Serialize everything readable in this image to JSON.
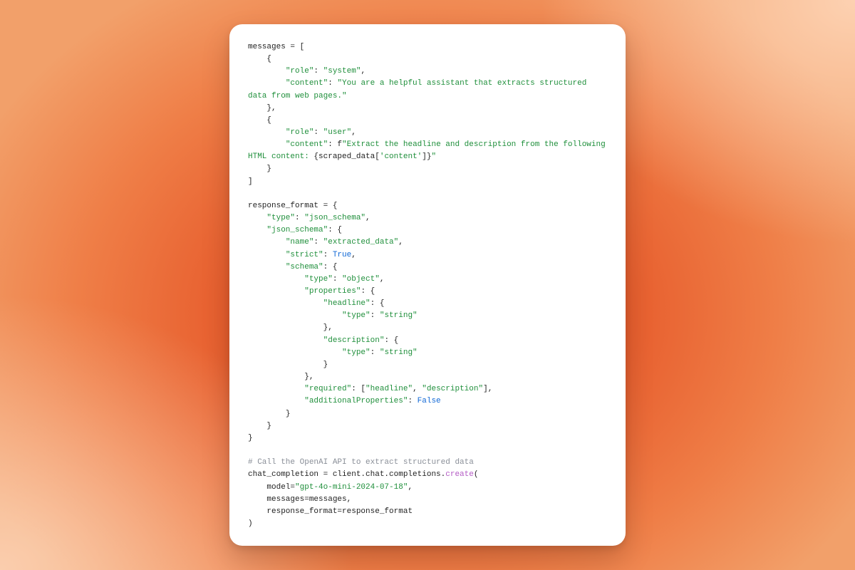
{
  "code": {
    "l1": "messages = [",
    "l2": "    {",
    "l3a": "        ",
    "l3_role_key": "\"role\"",
    "l3b": ": ",
    "l3_role_val": "\"system\"",
    "l3c": ",",
    "l4a": "        ",
    "l4_key": "\"content\"",
    "l4b": ": ",
    "l4_val": "\"You are a helpful assistant that extracts structured data from web pages.\"",
    "l5": "    },",
    "l6": "    {",
    "l7a": "        ",
    "l7_key": "\"role\"",
    "l7b": ": ",
    "l7_val": "\"user\"",
    "l7c": ",",
    "l8a": "        ",
    "l8_key": "\"content\"",
    "l8b": ": f",
    "l8_str1": "\"Extract the headline and description from the following HTML content: ",
    "l8_open": "{",
    "l8_expr": "scraped_data[",
    "l8_idx": "'content'",
    "l8_expr2": "]",
    "l8_close": "}",
    "l8_str2": "\"",
    "l9": "    }",
    "l10": "]",
    "l12": "response_format = {",
    "l13a": "    ",
    "l13_key": "\"type\"",
    "l13b": ": ",
    "l13_val": "\"json_schema\"",
    "l13c": ",",
    "l14a": "    ",
    "l14_key": "\"json_schema\"",
    "l14b": ": {",
    "l15a": "        ",
    "l15_key": "\"name\"",
    "l15b": ": ",
    "l15_val": "\"extracted_data\"",
    "l15c": ",",
    "l16a": "        ",
    "l16_key": "\"strict\"",
    "l16b": ": ",
    "l16_val": "True",
    "l16c": ",",
    "l17a": "        ",
    "l17_key": "\"schema\"",
    "l17b": ": {",
    "l18a": "            ",
    "l18_key": "\"type\"",
    "l18b": ": ",
    "l18_val": "\"object\"",
    "l18c": ",",
    "l19a": "            ",
    "l19_key": "\"properties\"",
    "l19b": ": {",
    "l20a": "                ",
    "l20_key": "\"headline\"",
    "l20b": ": {",
    "l21a": "                    ",
    "l21_key": "\"type\"",
    "l21b": ": ",
    "l21_val": "\"string\"",
    "l22": "                },",
    "l23a": "                ",
    "l23_key": "\"description\"",
    "l23b": ": {",
    "l24a": "                    ",
    "l24_key": "\"type\"",
    "l24b": ": ",
    "l24_val": "\"string\"",
    "l25": "                }",
    "l26": "            },",
    "l27a": "            ",
    "l27_key": "\"required\"",
    "l27b": ": [",
    "l27_v1": "\"headline\"",
    "l27c": ", ",
    "l27_v2": "\"description\"",
    "l27d": "],",
    "l28a": "            ",
    "l28_key": "\"additionalProperties\"",
    "l28b": ": ",
    "l28_val": "False",
    "l29": "        }",
    "l30": "    }",
    "l31": "}",
    "l33": "# Call the OpenAI API to extract structured data",
    "l34a": "chat_completion = client.chat.completions.",
    "l34_fn": "create",
    "l34b": "(",
    "l35a": "    model=",
    "l35_val": "\"gpt-4o-mini-2024-07-18\"",
    "l35b": ",",
    "l36": "    messages=messages,",
    "l37": "    response_format=response_format",
    "l38": ")"
  }
}
